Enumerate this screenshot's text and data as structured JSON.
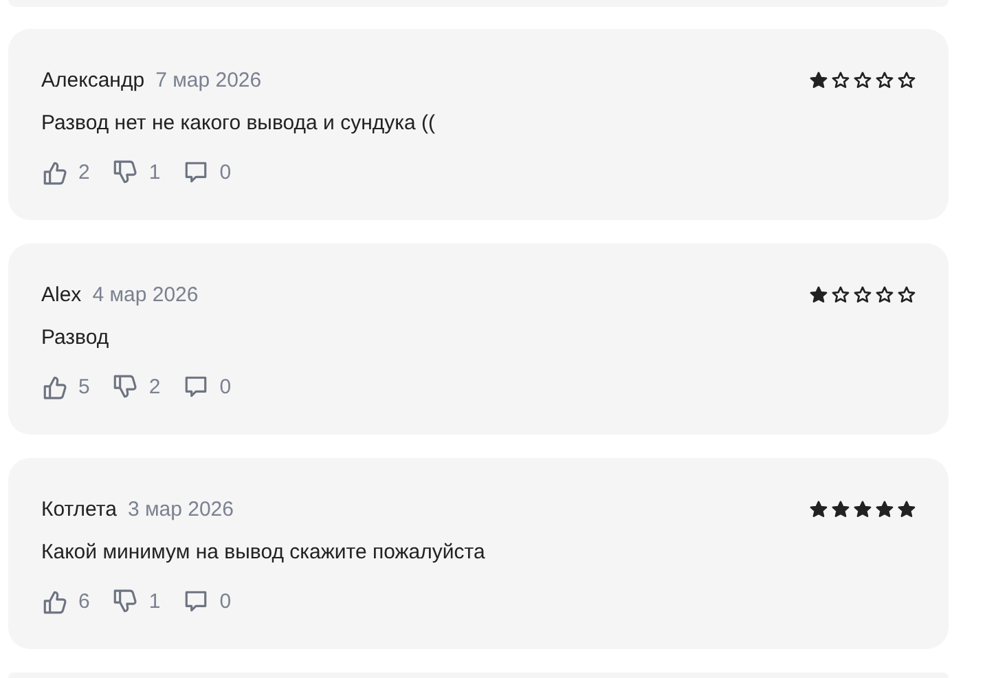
{
  "reviews": [
    {
      "author": "Александр",
      "date": "7 мар 2026",
      "stars": 1,
      "text": "Развод нет не какого вывода и сундука ((",
      "likes": "2",
      "dislikes": "1",
      "comments": "0"
    },
    {
      "author": "Alex",
      "date": "4 мар 2026",
      "stars": 1,
      "text": "Развод",
      "likes": "5",
      "dislikes": "2",
      "comments": "0"
    },
    {
      "author": "Котлета",
      "date": "3 мар 2026",
      "stars": 5,
      "text": "Какой минимум на вывод скажите пожалуйста",
      "likes": "6",
      "dislikes": "1",
      "comments": "0"
    }
  ]
}
